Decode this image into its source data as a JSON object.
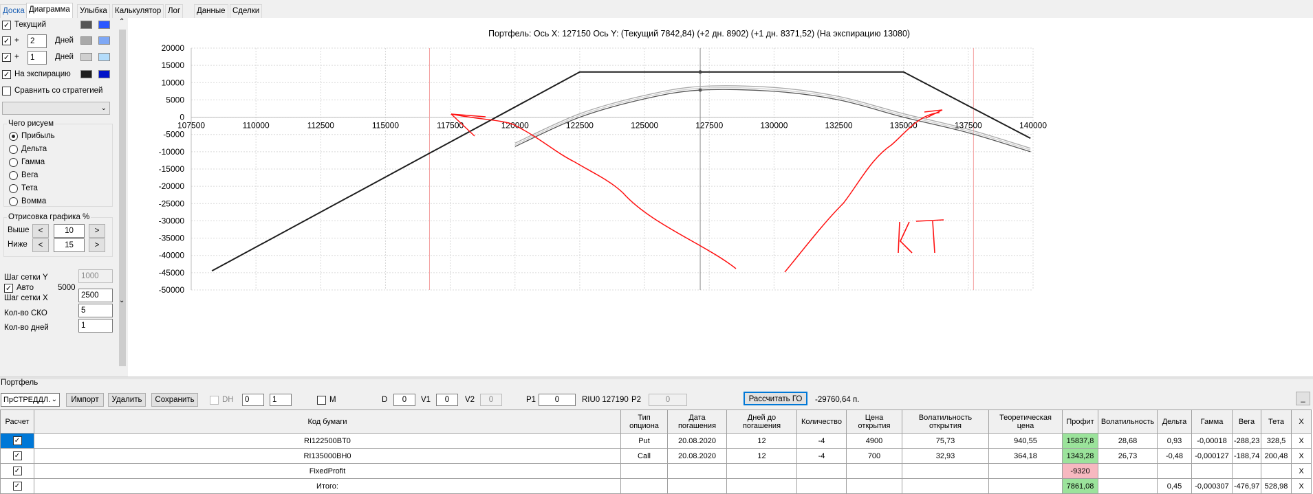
{
  "tabs": [
    "Доска",
    "Диаграмма",
    "Улыбка",
    "Калькулятор",
    "Лог",
    "Данные",
    "Сделки"
  ],
  "active_tab": 1,
  "left_panel": {
    "current_label": "Текущий",
    "plus1": "+",
    "plus2": "+",
    "days1": "2",
    "days2": "1",
    "days_label_1": "Дней",
    "days_label_2": "Дней",
    "expiration_label": "На экспирацию",
    "compare_label": "Сравнить со стратегией",
    "what_to_draw_title": "Чего рисуем",
    "radio_options": [
      "Прибыль",
      "Дельта",
      "Гамма",
      "Вега",
      "Тета",
      "Вомма"
    ],
    "selected_radio": 0,
    "drawing_title": "Отрисовка графика %",
    "above_label": "Выше",
    "above_value": "10",
    "below_label": "Ниже",
    "below_value": "15",
    "prev": "<",
    "next": ">",
    "grid_y_label": "Шаг сетки Y",
    "grid_y_value": "1000",
    "auto_label": "Авто",
    "auto_value": "5000",
    "grid_x_label": "Шаг сетки X",
    "grid_x_value": "2500",
    "sko_label": "Кол-во СКО",
    "sko_value": "5",
    "days_count_label": "Кол-во дней",
    "days_count_value": "1",
    "swatch_colors": [
      [
        "#555555",
        "#2b57ff"
      ],
      [
        "#a9a9a9",
        "#7fa8f5"
      ],
      [
        "#cfcfcf",
        "#b3dcfb"
      ],
      [
        "#1e1e1e",
        "#0012c8"
      ]
    ]
  },
  "chart_title": "Портфель: Ось X:  127150 Ось Y:   (Текущий 7842,84)  (+2 дн. 8902)  (+1 дн. 8371,52)  (На экспирацию 13080)",
  "annotation": "KT",
  "chart_data": {
    "type": "line",
    "xlim": [
      107500,
      140000
    ],
    "ylim": [
      -50000,
      20000
    ],
    "x_ticks": [
      "107500",
      "110000",
      "112500",
      "115000",
      "117500",
      "120000",
      "122500",
      "125000",
      "127500",
      "130000",
      "132500",
      "135000",
      "137500",
      "140000"
    ],
    "y_ticks": [
      "20000",
      "15000",
      "10000",
      "5000",
      "0",
      "-5000",
      "-10000",
      "-15000",
      "-20000",
      "-25000",
      "-30000",
      "-35000",
      "-40000",
      "-45000",
      "-50000"
    ],
    "cursor_x": 127150,
    "vlines": [
      116700,
      137700
    ],
    "series": [
      {
        "name": "На экспирацию",
        "color": "#1e1e1e",
        "x": [
          108300,
          122500,
          135000,
          139900
        ],
        "y": [
          -44500,
          13080,
          13080,
          -6100
        ]
      },
      {
        "name": "Текущий",
        "color": "#555555",
        "x": [
          120000,
          122500,
          125000,
          127150,
          130000,
          132500,
          135000,
          137500,
          139900
        ],
        "y": [
          -8500,
          0,
          5300,
          7843,
          7500,
          5000,
          0,
          -4500,
          -10000
        ]
      },
      {
        "name": "+2 дн.",
        "color": "#a9a9a9",
        "x": [
          120000,
          122500,
          125000,
          127150,
          130000,
          132500,
          135000,
          137500,
          139900
        ],
        "y": [
          -7500,
          1000,
          6300,
          8902,
          8600,
          6000,
          1000,
          -3500,
          -9000
        ]
      },
      {
        "name": "+1 дн.",
        "color": "#cfcfcf",
        "x": [
          120000,
          122500,
          125000,
          127150,
          130000,
          132500,
          135000,
          137500,
          139900
        ],
        "y": [
          -8000,
          500,
          5800,
          8372,
          8000,
          5500,
          500,
          -4000,
          -9500
        ]
      }
    ]
  },
  "bottom": {
    "portfolio_label": "Портфель",
    "portfolio_select": "ПрСТРЕДДЛ.",
    "import": "Импорт",
    "delete": "Удалить",
    "save": "Сохранить",
    "dh": "DH",
    "dh_val1": "0",
    "dh_val2": "1",
    "m": "M",
    "d_label": "D",
    "d_value": "0",
    "v1_label": "V1",
    "v1_value": "0",
    "v2_label": "V2",
    "v2_value": "0",
    "p1_label": "P1",
    "p1_value": "0",
    "riu": "RIU0 127190",
    "p2_label": "P2",
    "p2_value": "0",
    "calc_go": "Рассчитать ГО",
    "go_value": "-29760,64 п.",
    "small_btn": "_"
  },
  "table": {
    "headers": [
      "Расчет",
      "Код бумаги",
      "Тип опциона",
      "Дата погашения",
      "Дней до погашения",
      "Количество",
      "Цена открытия",
      "Волатильность открытия",
      "Теоретическая цена",
      "Профит",
      "Волатильность",
      "Дельта",
      "Гамма",
      "Вега",
      "Тета",
      "X"
    ],
    "rows": [
      [
        "✓",
        "RI122500BT0",
        "Put",
        "20.08.2020",
        "12",
        "-4",
        "4900",
        "75,73",
        "940,55",
        "15837,8",
        "28,68",
        "0,93",
        "-0,00018",
        "-288,23",
        "328,5",
        "X"
      ],
      [
        "✓",
        "RI135000BH0",
        "Call",
        "20.08.2020",
        "12",
        "-4",
        "700",
        "32,93",
        "364,18",
        "1343,28",
        "26,73",
        "-0,48",
        "-0,000127",
        "-188,74",
        "200,48",
        "X"
      ],
      [
        "✓",
        "FixedProfit",
        "",
        "",
        "",
        "",
        "",
        "",
        "",
        "-9320",
        "",
        "",
        "",
        "",
        "",
        "X"
      ],
      [
        "✓",
        "Итого:",
        "",
        "",
        "",
        "",
        "",
        "",
        "",
        "7861,08",
        "",
        "0,45",
        "-0,000307",
        "-476,97",
        "528,98",
        "X"
      ]
    ]
  }
}
